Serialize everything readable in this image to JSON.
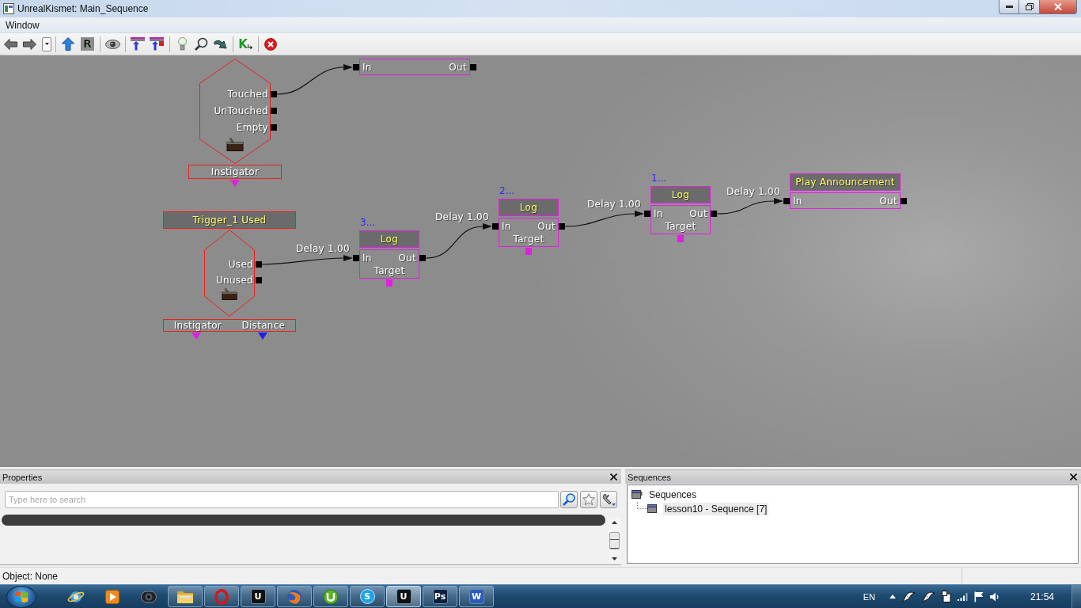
{
  "window": {
    "title": "UnrealKismet: Main_Sequence"
  },
  "menu": [
    {
      "label": "Window"
    }
  ],
  "toolbar": {
    "groups": [
      [
        {
          "kind": "back"
        },
        {
          "kind": "forward"
        },
        {
          "kind": "history"
        }
      ],
      [
        {
          "kind": "parent"
        },
        {
          "kind": "letter",
          "label": "R"
        }
      ],
      [
        {
          "kind": "eye"
        }
      ],
      [
        {
          "kind": "pin"
        },
        {
          "kind": "pin2"
        }
      ],
      [
        {
          "kind": "bulb"
        },
        {
          "kind": "zoom"
        },
        {
          "kind": "turn"
        }
      ],
      [
        {
          "kind": "letterarrow",
          "label": "K"
        }
      ],
      [
        {
          "kind": "stop"
        }
      ]
    ]
  },
  "canvas": {
    "events": [
      {
        "outputs": [
          "Touched",
          "UnTouched",
          "Empty"
        ],
        "variables": [
          {
            "label": "Instigator",
            "color": "#e020e0"
          }
        ]
      },
      {
        "title": "Trigger_1 Used",
        "outputs": [
          "Used",
          "Unused"
        ],
        "variables": [
          {
            "label": "Instigator",
            "color": "#e020e0"
          },
          {
            "label": "Distance",
            "color": "#2020e8"
          }
        ]
      }
    ],
    "actions": [
      {
        "inputs": [
          "In"
        ],
        "outputs": [
          "Out"
        ]
      },
      {
        "comment": "3...",
        "title": "Log",
        "inputs": [
          "In"
        ],
        "outputs": [
          "Out"
        ],
        "variables": [
          "Target"
        ]
      },
      {
        "comment": "2...",
        "title": "Log",
        "inputs": [
          "In"
        ],
        "outputs": [
          "Out"
        ],
        "variables": [
          "Target"
        ]
      },
      {
        "comment": "1...",
        "title": "Log",
        "inputs": [
          "In"
        ],
        "outputs": [
          "Out"
        ],
        "variables": [
          "Target"
        ]
      },
      {
        "title": "Play Announcement",
        "inputs": [
          "In"
        ],
        "outputs": [
          "Out"
        ]
      }
    ],
    "links": [
      {
        "kind": "wire"
      },
      {
        "kind": "wire",
        "label": "Delay 1.00"
      },
      {
        "kind": "wire",
        "label": "Delay 1.00"
      },
      {
        "kind": "wire",
        "label": "Delay 1.00"
      },
      {
        "kind": "wire",
        "label": "Delay 1.00"
      }
    ]
  },
  "properties_panel": {
    "title": "Properties",
    "search": {
      "placeholder": "Type here to search"
    }
  },
  "sequences_panel": {
    "title": "Sequences",
    "tree": [
      {
        "label": "Sequences",
        "selected": false,
        "children": [
          {
            "label": "lesson10 - Sequence [7]",
            "selected": true
          }
        ]
      }
    ]
  },
  "status_bar": {
    "text": "Object: None"
  },
  "taskbar": {
    "apps": [
      {
        "kind": "orbit",
        "running": false,
        "selected": false
      },
      {
        "kind": "play",
        "running": false,
        "selected": false
      },
      {
        "kind": "camera",
        "running": false,
        "selected": false
      },
      {
        "kind": "folder",
        "running": true,
        "selected": false
      },
      {
        "kind": "ring",
        "running": true,
        "selected": false
      },
      {
        "kind": "letter",
        "glyph": "U",
        "color": "#111111",
        "running": true,
        "selected": false
      },
      {
        "kind": "globe",
        "running": true,
        "selected": false
      },
      {
        "kind": "disc",
        "running": true,
        "selected": false
      },
      {
        "kind": "round",
        "glyph": "S",
        "color": "#1fa3e8",
        "running": true,
        "selected": false
      },
      {
        "kind": "letter",
        "glyph": "U",
        "color": "#111111",
        "running": true,
        "selected": true
      },
      {
        "kind": "letter",
        "glyph": "Ps",
        "color": "#0b1f3f",
        "running": true,
        "selected": false
      },
      {
        "kind": "letter",
        "glyph": "W",
        "color": "#2b5bb8",
        "running": true,
        "selected": false
      }
    ],
    "tray": {
      "language": "EN",
      "clock": "21:54"
    }
  }
}
